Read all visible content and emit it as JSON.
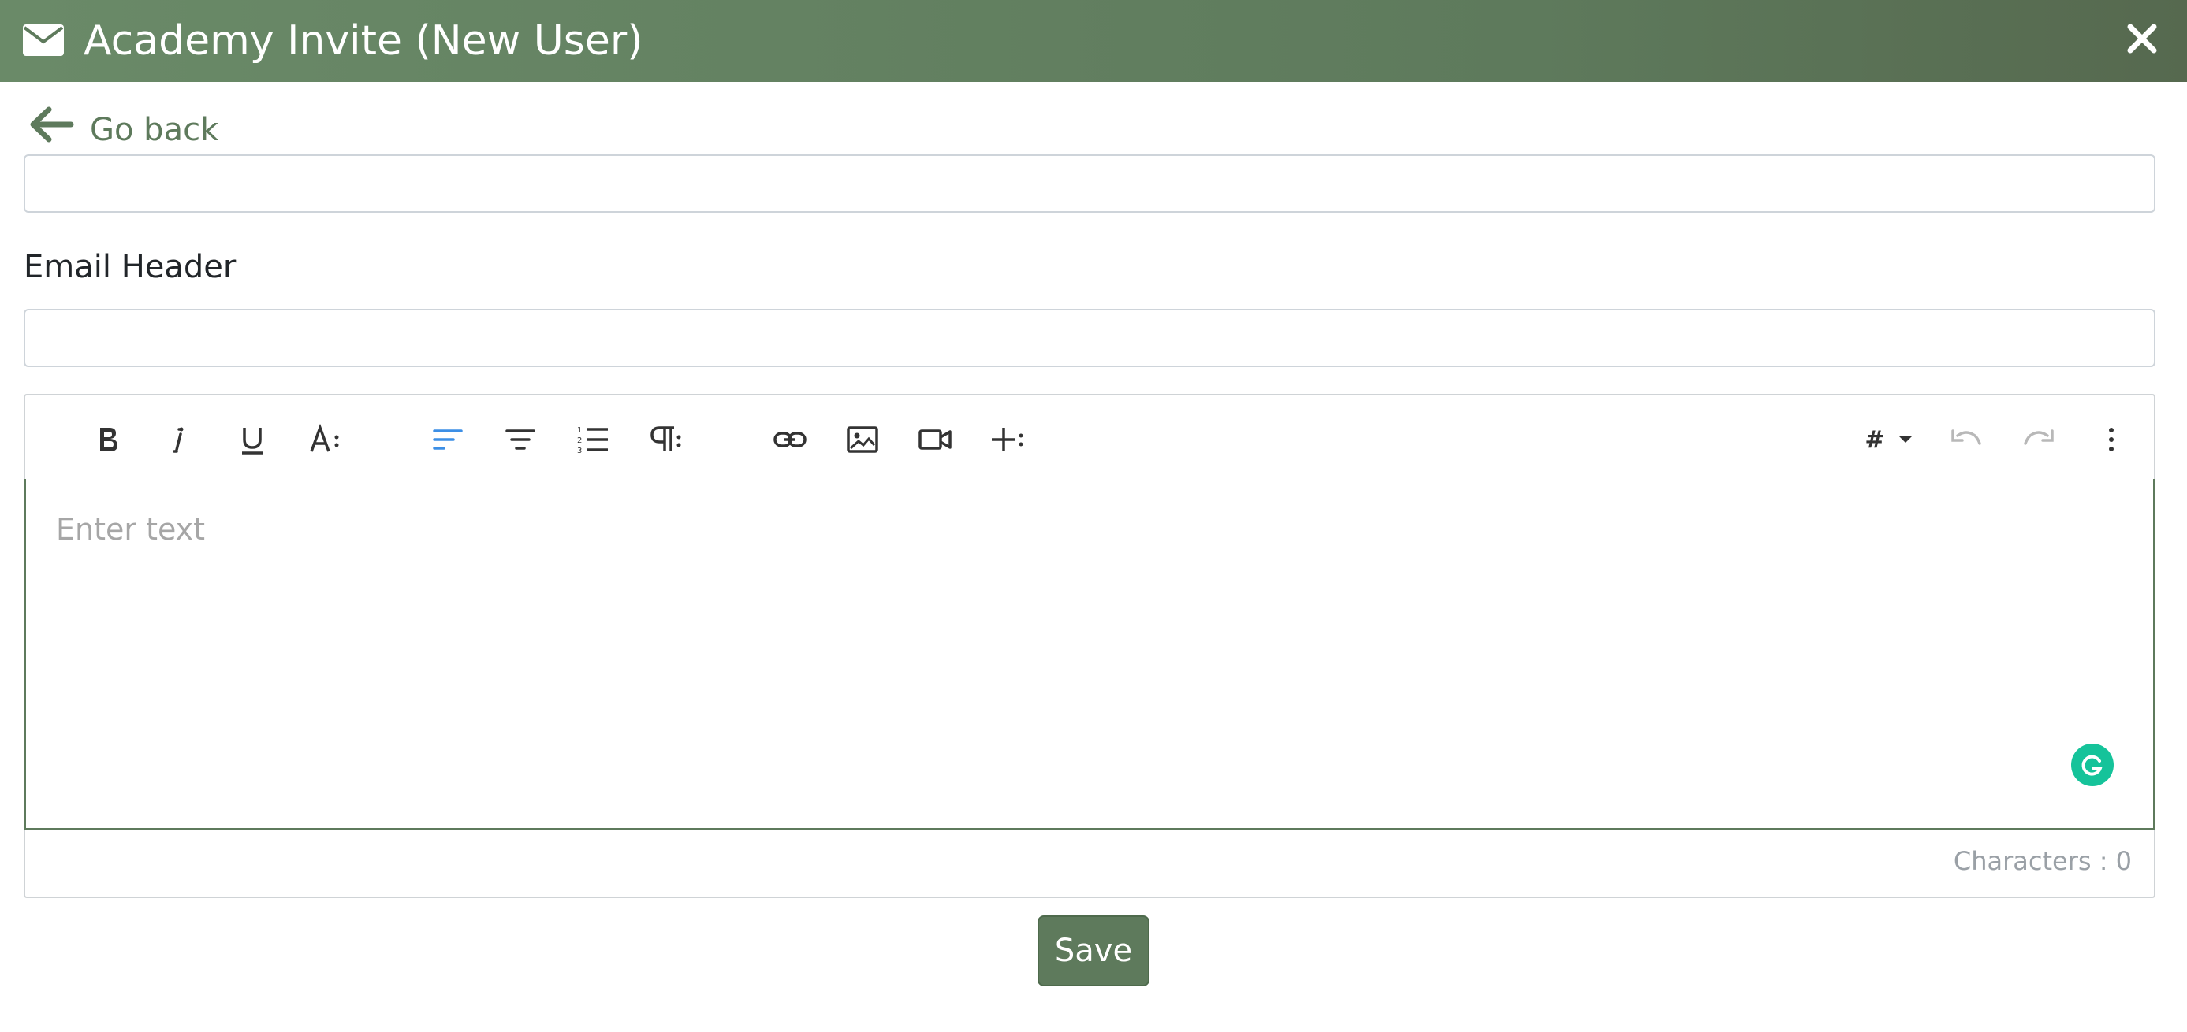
{
  "modal": {
    "title": "Academy Invite (New User)",
    "header_color": "#5e7a5c"
  },
  "back": {
    "label": "Go back"
  },
  "subject": {
    "value": "",
    "placeholder": ""
  },
  "email_header": {
    "label": "Email Header",
    "value": "",
    "placeholder": ""
  },
  "editor": {
    "placeholder": "Enter text",
    "toolbar": {
      "hash_label": "#"
    },
    "char_count": "Characters : 0"
  },
  "actions": {
    "save_label": "Save"
  },
  "colors": {
    "accent": "#5e7a5c",
    "active_align": "#3d8fe6",
    "grammarly": "#15c39a"
  }
}
